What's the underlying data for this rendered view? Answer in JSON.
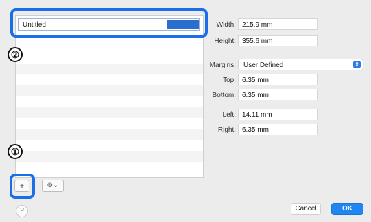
{
  "list": {
    "name_value": "Untitled"
  },
  "annotations": {
    "badge_one": "①",
    "badge_two": "②"
  },
  "list_controls": {
    "add_label": "+",
    "action_icon": "gear-icon",
    "action_glyph": "⊙",
    "chevron_glyph": "⌄"
  },
  "paper": {
    "width_label": "Width:",
    "width_value": "215.9 mm",
    "height_label": "Height:",
    "height_value": "355.6 mm"
  },
  "margins": {
    "label": "Margins:",
    "selected": "User Defined",
    "top_label": "Top:",
    "top_value": "6.35 mm",
    "bottom_label": "Bottom:",
    "bottom_value": "6.35 mm",
    "left_label": "Left:",
    "left_value": "14.11 mm",
    "right_label": "Right:",
    "right_value": "6.35 mm"
  },
  "footer": {
    "help_label": "?",
    "cancel_label": "Cancel",
    "ok_label": "OK"
  },
  "colors": {
    "highlight": "#1a6ee8",
    "ok_button": "#1f86f2",
    "selection": "#2a6fd0"
  }
}
